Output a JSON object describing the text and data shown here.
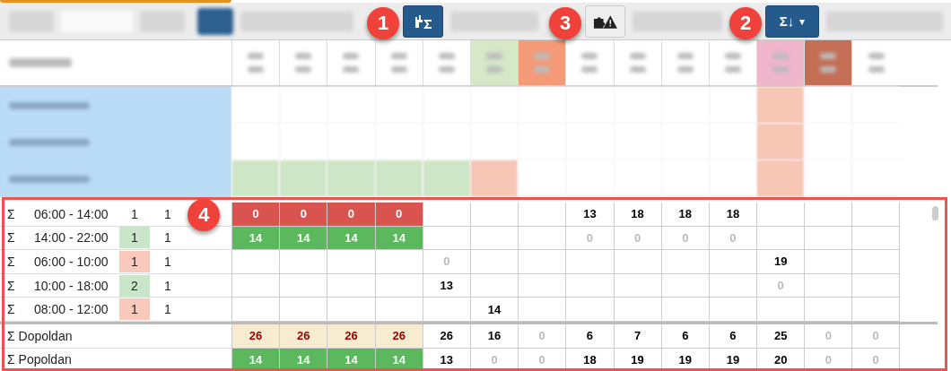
{
  "toolbar": {
    "buttons": [
      {
        "kind": "tree-sum",
        "selected": true
      },
      {
        "kind": "puzzle-warning",
        "selected": false
      },
      {
        "kind": "sum-sort",
        "label": "Σ↓",
        "caret": "▾",
        "selected": true
      }
    ]
  },
  "summary": {
    "shift_rows": [
      {
        "symbol": "Σ",
        "time": "06:00 - 14:00",
        "required": {
          "text": "1"
        },
        "assigned": "1",
        "cells": [
          {
            "text": "0",
            "kind": "red"
          },
          {
            "text": "0",
            "kind": "red"
          },
          {
            "text": "0",
            "kind": "red"
          },
          {
            "text": "0",
            "kind": "red"
          },
          null,
          null,
          null,
          {
            "text": "13",
            "kind": "bold"
          },
          {
            "text": "18",
            "kind": "bold"
          },
          {
            "text": "18",
            "kind": "bold"
          },
          {
            "text": "18",
            "kind": "bold"
          },
          null,
          null,
          null
        ]
      },
      {
        "symbol": "Σ",
        "time": "14:00 - 22:00",
        "required": {
          "text": "1",
          "color": "#c9e6c9"
        },
        "assigned": "1",
        "cells": [
          {
            "text": "14",
            "kind": "green"
          },
          {
            "text": "14",
            "kind": "green"
          },
          {
            "text": "14",
            "kind": "green"
          },
          {
            "text": "14",
            "kind": "green"
          },
          null,
          null,
          null,
          {
            "text": "0",
            "kind": "muted"
          },
          {
            "text": "0",
            "kind": "muted"
          },
          {
            "text": "0",
            "kind": "muted"
          },
          {
            "text": "0",
            "kind": "muted"
          },
          null,
          null,
          null
        ]
      },
      {
        "symbol": "Σ",
        "time": "06:00 - 10:00",
        "required": {
          "text": "1",
          "color": "#f9c9bb"
        },
        "assigned": "1",
        "cells": [
          null,
          null,
          null,
          null,
          {
            "text": "0",
            "kind": "muted"
          },
          null,
          null,
          null,
          null,
          null,
          null,
          {
            "text": "19",
            "kind": "bold"
          },
          null,
          null
        ]
      },
      {
        "symbol": "Σ",
        "time": "10:00 - 18:00",
        "required": {
          "text": "2",
          "color": "#c9e6c9"
        },
        "assigned": "1",
        "cells": [
          null,
          null,
          null,
          null,
          {
            "text": "13",
            "kind": "bold"
          },
          null,
          null,
          null,
          null,
          null,
          null,
          {
            "text": "0",
            "kind": "muted"
          },
          null,
          null
        ]
      },
      {
        "symbol": "Σ",
        "time": "08:00 - 12:00",
        "required": {
          "text": "1",
          "color": "#f9c9bb"
        },
        "assigned": "1",
        "cells": [
          null,
          null,
          null,
          null,
          null,
          {
            "text": "14",
            "kind": "bold"
          },
          null,
          null,
          null,
          null,
          null,
          null,
          null,
          null
        ]
      }
    ],
    "total_rows": [
      {
        "label": "Σ Dopoldan",
        "cells": [
          {
            "text": "26",
            "kind": "beige"
          },
          {
            "text": "26",
            "kind": "beige"
          },
          {
            "text": "26",
            "kind": "beige"
          },
          {
            "text": "26",
            "kind": "beige"
          },
          {
            "text": "26",
            "kind": "bold"
          },
          {
            "text": "16",
            "kind": "bold"
          },
          {
            "text": "0",
            "kind": "muted"
          },
          {
            "text": "6",
            "kind": "bold"
          },
          {
            "text": "7",
            "kind": "bold"
          },
          {
            "text": "6",
            "kind": "bold"
          },
          {
            "text": "6",
            "kind": "bold"
          },
          {
            "text": "25",
            "kind": "bold"
          },
          {
            "text": "0",
            "kind": "muted"
          },
          {
            "text": "0",
            "kind": "muted"
          }
        ]
      },
      {
        "label": "Σ Popoldan",
        "cells": [
          {
            "text": "14",
            "kind": "green"
          },
          {
            "text": "14",
            "kind": "green"
          },
          {
            "text": "14",
            "kind": "green"
          },
          {
            "text": "14",
            "kind": "green"
          },
          {
            "text": "13",
            "kind": "bold"
          },
          {
            "text": "0",
            "kind": "muted"
          },
          {
            "text": "0",
            "kind": "muted"
          },
          {
            "text": "18",
            "kind": "bold"
          },
          {
            "text": "19",
            "kind": "bold"
          },
          {
            "text": "19",
            "kind": "bold"
          },
          {
            "text": "19",
            "kind": "bold"
          },
          {
            "text": "20",
            "kind": "bold"
          },
          {
            "text": "0",
            "kind": "muted"
          },
          {
            "text": "0",
            "kind": "muted"
          }
        ]
      }
    ]
  },
  "callouts": [
    {
      "number": "1"
    },
    {
      "number": "3"
    },
    {
      "number": "2"
    },
    {
      "number": "4"
    }
  ]
}
